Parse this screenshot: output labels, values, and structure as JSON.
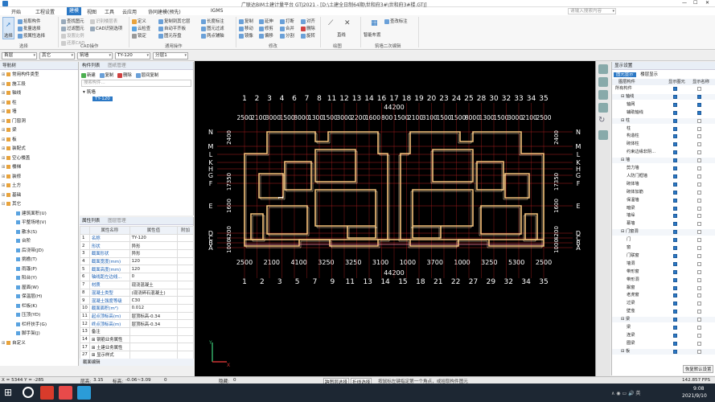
{
  "title": "广联达BIM土建计量平台 GTJ2021 - [D:\\土建全日制64期\\世和府3#\\世和府3#楼.GTJ]",
  "tabs": [
    "开始",
    "工程设置",
    "建模",
    "视图",
    "工具",
    "云应用",
    "协同建模(预先)",
    "IGMS"
  ],
  "active_tab": "建模",
  "search_placeholder": "请输入搜索内容",
  "ribbon": {
    "select": "选择",
    "col1": [
      "拾取构件",
      "批量选择",
      "按属性选择"
    ],
    "col2": [
      "查找图元",
      "过滤图元",
      "设置比例",
      "还原CAD"
    ],
    "col3": [
      "识别楼层表",
      "CAD识别选项"
    ],
    "col4": [
      "定义",
      "云检查",
      "锁定"
    ],
    "col5": [
      "复制到其它层",
      "自动平齐板",
      "图元存盘"
    ],
    "col6": [
      "长度标注",
      "图元过滤",
      "两点辅轴"
    ],
    "col7": [
      "复制",
      "移动",
      "镜像"
    ],
    "col8": [
      "延伸",
      "修剪",
      "偏移"
    ],
    "col9": [
      "打断",
      "合并",
      "分割"
    ],
    "col10": [
      "对齐",
      "删除",
      "旋转"
    ],
    "col11": [
      "直线"
    ],
    "col12": [
      "智能布置"
    ],
    "col13": [
      "查改标注"
    ],
    "groups": [
      "选择",
      "CAD操作",
      "通用操作",
      "修改",
      "绘图",
      "筑墙二次编辑"
    ]
  },
  "filter": [
    "首层",
    "其它",
    "筑墙",
    "TY-120",
    "分层1"
  ],
  "nav": {
    "header": "导航树",
    "items": [
      {
        "label": "常用构件类型",
        "ex": "⊞",
        "lvl": 0
      },
      {
        "label": "施工段",
        "ex": "⊞",
        "lvl": 0
      },
      {
        "label": "轴线",
        "ex": "⊞",
        "lvl": 0
      },
      {
        "label": "柱",
        "ex": "⊞",
        "lvl": 0
      },
      {
        "label": "墙",
        "ex": "⊞",
        "lvl": 0
      },
      {
        "label": "门窗洞",
        "ex": "⊞",
        "lvl": 0
      },
      {
        "label": "梁",
        "ex": "⊞",
        "lvl": 0
      },
      {
        "label": "板",
        "ex": "⊞",
        "lvl": 0
      },
      {
        "label": "装配式",
        "ex": "⊞",
        "lvl": 0
      },
      {
        "label": "空心楼盖",
        "ex": "⊞",
        "lvl": 0
      },
      {
        "label": "楼梯",
        "ex": "⊞",
        "lvl": 0
      },
      {
        "label": "装修",
        "ex": "⊞",
        "lvl": 0
      },
      {
        "label": "土方",
        "ex": "⊞",
        "lvl": 0
      },
      {
        "label": "基础",
        "ex": "⊞",
        "lvl": 0
      },
      {
        "label": "其它",
        "ex": "⊟",
        "lvl": 0
      },
      {
        "label": "建筑面积(U)",
        "ex": "",
        "lvl": 1
      },
      {
        "label": "平整场地(V)",
        "ex": "",
        "lvl": 1
      },
      {
        "label": "散水(S)",
        "ex": "",
        "lvl": 1
      },
      {
        "label": "台阶",
        "ex": "",
        "lvl": 1
      },
      {
        "label": "后浇带(JD)",
        "ex": "",
        "lvl": 1
      },
      {
        "label": "挑檐(T)",
        "ex": "",
        "lvl": 1
      },
      {
        "label": "雨篷(P)",
        "ex": "",
        "lvl": 1
      },
      {
        "label": "阳台(Y)",
        "ex": "",
        "lvl": 1
      },
      {
        "label": "屋面(W)",
        "ex": "",
        "lvl": 1
      },
      {
        "label": "保温层(H)",
        "ex": "",
        "lvl": 1
      },
      {
        "label": "栏板(K)",
        "ex": "",
        "lvl": 1
      },
      {
        "label": "压顶(YD)",
        "ex": "",
        "lvl": 1
      },
      {
        "label": "栏杆扶手(G)",
        "ex": "",
        "lvl": 1
      },
      {
        "label": "脚手架(J)",
        "ex": "",
        "lvl": 1
      },
      {
        "label": "自定义",
        "ex": "⊞",
        "lvl": 0
      }
    ]
  },
  "list": {
    "tabs": [
      "构件列表",
      "图纸管理"
    ],
    "tools": [
      "新建",
      "复制",
      "删除",
      "层间复制"
    ],
    "search": "搜索构件...",
    "tree_root": "筑墙",
    "tree_item": "TY-120"
  },
  "props": {
    "tabs": [
      "属性列表",
      "图层管理"
    ],
    "headers": [
      "属性名称",
      "属性值",
      "附加"
    ],
    "rows": [
      [
        "1",
        "名称",
        "TY-120",
        ""
      ],
      [
        "2",
        "形状",
        "异形",
        ""
      ],
      [
        "3",
        "截面形状",
        "异形",
        ""
      ],
      [
        "4",
        "截面宽度(mm)",
        "120",
        ""
      ],
      [
        "5",
        "截面高度(mm)",
        "120",
        ""
      ],
      [
        "6",
        "轴线距左边线...",
        "0",
        ""
      ],
      [
        "7",
        "材质",
        "现浇混凝土",
        ""
      ],
      [
        "8",
        "混凝土类型",
        "(现浇碎石混凝土)",
        ""
      ],
      [
        "9",
        "混凝土强度等级",
        "C30",
        ""
      ],
      [
        "10",
        "截面面积(m²)",
        "0.012",
        ""
      ],
      [
        "11",
        "起点顶标高(m)",
        "层顶标高-0.34",
        ""
      ],
      [
        "12",
        "终点顶标高(m)",
        "层顶标高-0.34",
        ""
      ],
      [
        "13",
        "备注",
        "",
        ""
      ],
      [
        "14",
        "⊞ 钢筋业务属性",
        "",
        ""
      ],
      [
        "17",
        "⊞ 土建业务属性",
        "",
        ""
      ],
      [
        "27",
        "⊞ 显示样式",
        "",
        ""
      ]
    ],
    "footer": "截面编辑"
  },
  "cad": {
    "top_axes": [
      "1",
      "2",
      "3",
      "4",
      "6",
      "7",
      "8",
      "11",
      "12",
      "13",
      "14",
      "16",
      "17",
      "18",
      "19",
      "20",
      "23",
      "24",
      "25",
      "28",
      "30",
      "32",
      "33",
      "34",
      "35"
    ],
    "top_dims": [
      "2500",
      "2100",
      "3000",
      "1500",
      "8000",
      "1300",
      "1500",
      "3000",
      "2200",
      "1600",
      "800",
      "1500",
      "2100",
      "3100",
      "1500",
      "1500",
      "8000",
      "1300",
      "1500",
      "3000",
      "2100",
      "2500"
    ],
    "top_total": "44200",
    "bot_axes": [
      "1",
      "2",
      "3",
      "5",
      "7",
      "9",
      "11",
      "13",
      "14",
      "15",
      "18",
      "21",
      "22",
      "27",
      "29",
      "32",
      "34",
      "35"
    ],
    "bot_dims": [
      "2500",
      "2100",
      "4100",
      "3250",
      "3250",
      "3100",
      "1000",
      "3700",
      "1000",
      "3250",
      "5300",
      "2500"
    ],
    "bot_total": "44200",
    "rows": [
      "N",
      "M",
      "L",
      "K",
      "H",
      "G",
      "F",
      "E",
      "D",
      "C",
      "B",
      "A"
    ],
    "left_dims": [
      "2400",
      "17350",
      "1600",
      "4200",
      "1000"
    ],
    "right_dims": [
      "2400",
      "17350",
      "1600",
      "4200",
      "1000"
    ],
    "tag": "1"
  },
  "display": {
    "header": "显示设置",
    "tabs": [
      "图元显示",
      "楼层显示"
    ],
    "cols": [
      "图层构件",
      "显示图元",
      "显示名称"
    ],
    "rows": [
      {
        "label": "所有构件",
        "lvl": 0,
        "a": true,
        "b": false
      },
      {
        "label": "⊟ 轴线",
        "lvl": 1,
        "a": true,
        "b": true
      },
      {
        "label": "轴网",
        "lvl": 2,
        "a": true,
        "b": true
      },
      {
        "label": "辅助轴线",
        "lvl": 2,
        "a": true,
        "b": true
      },
      {
        "label": "⊟ 柱",
        "lvl": 1,
        "a": true,
        "b": false
      },
      {
        "label": "柱",
        "lvl": 2,
        "a": true,
        "b": false
      },
      {
        "label": "构造柱",
        "lvl": 2,
        "a": true,
        "b": false
      },
      {
        "label": "砌体柱",
        "lvl": 2,
        "a": true,
        "b": false
      },
      {
        "label": "约束边缘非阴...",
        "lvl": 2,
        "a": true,
        "b": false
      },
      {
        "label": "⊟ 墙",
        "lvl": 1,
        "a": true,
        "b": false
      },
      {
        "label": "剪力墙",
        "lvl": 2,
        "a": true,
        "b": false
      },
      {
        "label": "人防门框墙",
        "lvl": 2,
        "a": true,
        "b": false
      },
      {
        "label": "砌体墙",
        "lvl": 2,
        "a": true,
        "b": false
      },
      {
        "label": "砌体加筋",
        "lvl": 2,
        "a": true,
        "b": false
      },
      {
        "label": "保温墙",
        "lvl": 2,
        "a": true,
        "b": false
      },
      {
        "label": "暗梁",
        "lvl": 2,
        "a": true,
        "b": false
      },
      {
        "label": "墙垛",
        "lvl": 2,
        "a": true,
        "b": false
      },
      {
        "label": "幕墙",
        "lvl": 2,
        "a": true,
        "b": false
      },
      {
        "label": "⊟ 门窗洞",
        "lvl": 1,
        "a": true,
        "b": false
      },
      {
        "label": "门",
        "lvl": 2,
        "a": true,
        "b": false
      },
      {
        "label": "窗",
        "lvl": 2,
        "a": true,
        "b": false
      },
      {
        "label": "门联窗",
        "lvl": 2,
        "a": true,
        "b": false
      },
      {
        "label": "墙洞",
        "lvl": 2,
        "a": true,
        "b": false
      },
      {
        "label": "带形窗",
        "lvl": 2,
        "a": true,
        "b": false
      },
      {
        "label": "带形洞",
        "lvl": 2,
        "a": true,
        "b": false
      },
      {
        "label": "飘窗",
        "lvl": 2,
        "a": true,
        "b": false
      },
      {
        "label": "老虎窗",
        "lvl": 2,
        "a": true,
        "b": false
      },
      {
        "label": "过梁",
        "lvl": 2,
        "a": true,
        "b": false
      },
      {
        "label": "壁龛",
        "lvl": 2,
        "a": true,
        "b": false
      },
      {
        "label": "⊟ 梁",
        "lvl": 1,
        "a": true,
        "b": false
      },
      {
        "label": "梁",
        "lvl": 2,
        "a": true,
        "b": false
      },
      {
        "label": "连梁",
        "lvl": 2,
        "a": true,
        "b": false
      },
      {
        "label": "圈梁",
        "lvl": 2,
        "a": true,
        "b": false
      },
      {
        "label": "⊟ 板",
        "lvl": 1,
        "a": true,
        "b": false
      }
    ],
    "restore": "恢复默认设置"
  },
  "status": {
    "coords": "X = 5344 Y = -285",
    "layer_h_label": "层高:",
    "layer_h": "3.15",
    "elev_label": "标高:",
    "elev": "-0.06~3.09",
    "val": "0",
    "hidden_label": "隐藏:",
    "hidden": "0",
    "buttons": [
      "跨图层选择",
      "折线选择"
    ],
    "hint": "按鼠标左键指定第一个角点，或拾取构件图元",
    "fps": "142.857 FPS"
  },
  "clock": {
    "time": "9:08",
    "date": "2021/9/10"
  },
  "colors": {
    "accent": "#2b78c5",
    "wall": "#f4c27a",
    "axis": "#b02020",
    "bg": "#000000"
  }
}
